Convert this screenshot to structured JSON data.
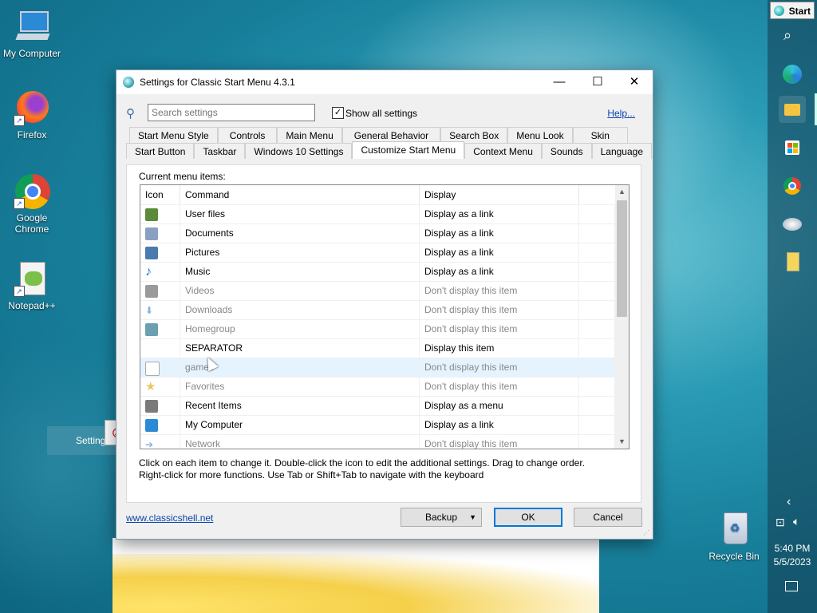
{
  "desktop": {
    "icons": [
      {
        "label": "My Computer",
        "icon": "computer-icon"
      },
      {
        "label": "Firefox",
        "icon": "firefox-icon"
      },
      {
        "label": "Google Chrome",
        "icon": "chrome-icon"
      },
      {
        "label": "Notepad++",
        "icon": "notepadpp-icon"
      },
      {
        "label": "Recycle Bin",
        "icon": "recycle-bin-icon"
      }
    ],
    "drag_ghost_label": "Settings"
  },
  "taskbar": {
    "start_label": "Start",
    "time": "5:40 PM",
    "date": "5/5/2023",
    "pinned": [
      "search-icon",
      "edge-icon",
      "file-explorer-icon",
      "store-icon",
      "chrome-icon",
      "classic-shell-icon",
      "file-icon"
    ]
  },
  "dialog": {
    "title": "Settings for Classic Start Menu 4.3.1",
    "search": {
      "placeholder": "Search settings",
      "value": ""
    },
    "show_all": {
      "label": "Show all settings",
      "checked": true
    },
    "help_link": "Help...",
    "tabs_row1": [
      "Start Menu Style",
      "Controls",
      "Main Menu",
      "General Behavior",
      "Search Box",
      "Menu Look",
      "Skin"
    ],
    "tabs_row2": [
      "Start Button",
      "Taskbar",
      "Windows 10 Settings",
      "Customize Start Menu",
      "Context Menu",
      "Sounds",
      "Language"
    ],
    "active_tab": "Customize Start Menu",
    "panel_label": "Current menu items:",
    "columns": [
      "Icon",
      "Command",
      "Display"
    ],
    "items": [
      {
        "command": "User files",
        "display": "Display as a link",
        "dim": false,
        "icon": "user-icon",
        "color": "#5a8a3a"
      },
      {
        "command": "Documents",
        "display": "Display as a link",
        "dim": false,
        "icon": "document-icon",
        "color": "#8aa0c0"
      },
      {
        "command": "Pictures",
        "display": "Display as a link",
        "dim": false,
        "icon": "pictures-icon",
        "color": "#4a7ab0"
      },
      {
        "command": "Music",
        "display": "Display as a link",
        "dim": false,
        "icon": "music-icon",
        "color": "#1a73d6"
      },
      {
        "command": "Videos",
        "display": "Don't display this item",
        "dim": true,
        "icon": "videos-icon",
        "color": "#9a9a9a"
      },
      {
        "command": "Downloads",
        "display": "Don't display this item",
        "dim": true,
        "icon": "downloads-icon",
        "color": "#8ab0dd"
      },
      {
        "command": "Homegroup",
        "display": "Don't display this item",
        "dim": true,
        "icon": "homegroup-icon",
        "color": "#6aa0b0"
      },
      {
        "command": "SEPARATOR",
        "display": "Display this item",
        "dim": false,
        "icon": "",
        "color": ""
      },
      {
        "command": "games",
        "display": "Don't display this item",
        "dim": true,
        "icon": "blank-file-icon",
        "color": "#ffffff"
      },
      {
        "command": "Favorites",
        "display": "Don't display this item",
        "dim": true,
        "icon": "star-icon",
        "color": "#e8c860"
      },
      {
        "command": "Recent Items",
        "display": "Display as a menu",
        "dim": false,
        "icon": "recent-items-icon",
        "color": "#7a7a7a"
      },
      {
        "command": "My Computer",
        "display": "Display as a link",
        "dim": false,
        "icon": "computer-icon",
        "color": "#2a8ad6"
      },
      {
        "command": "Network",
        "display": "Don't display this item",
        "dim": true,
        "icon": "network-icon",
        "color": "#8ab0dd"
      }
    ],
    "help_text_1": "Click on each item to change it. Double-click the icon to edit the additional settings. Drag to change order.",
    "help_text_2": "Right-click for more functions. Use Tab or Shift+Tab to navigate with the keyboard",
    "website_link": "www.classicshell.net",
    "buttons": {
      "backup": "Backup",
      "ok": "OK",
      "cancel": "Cancel"
    }
  }
}
